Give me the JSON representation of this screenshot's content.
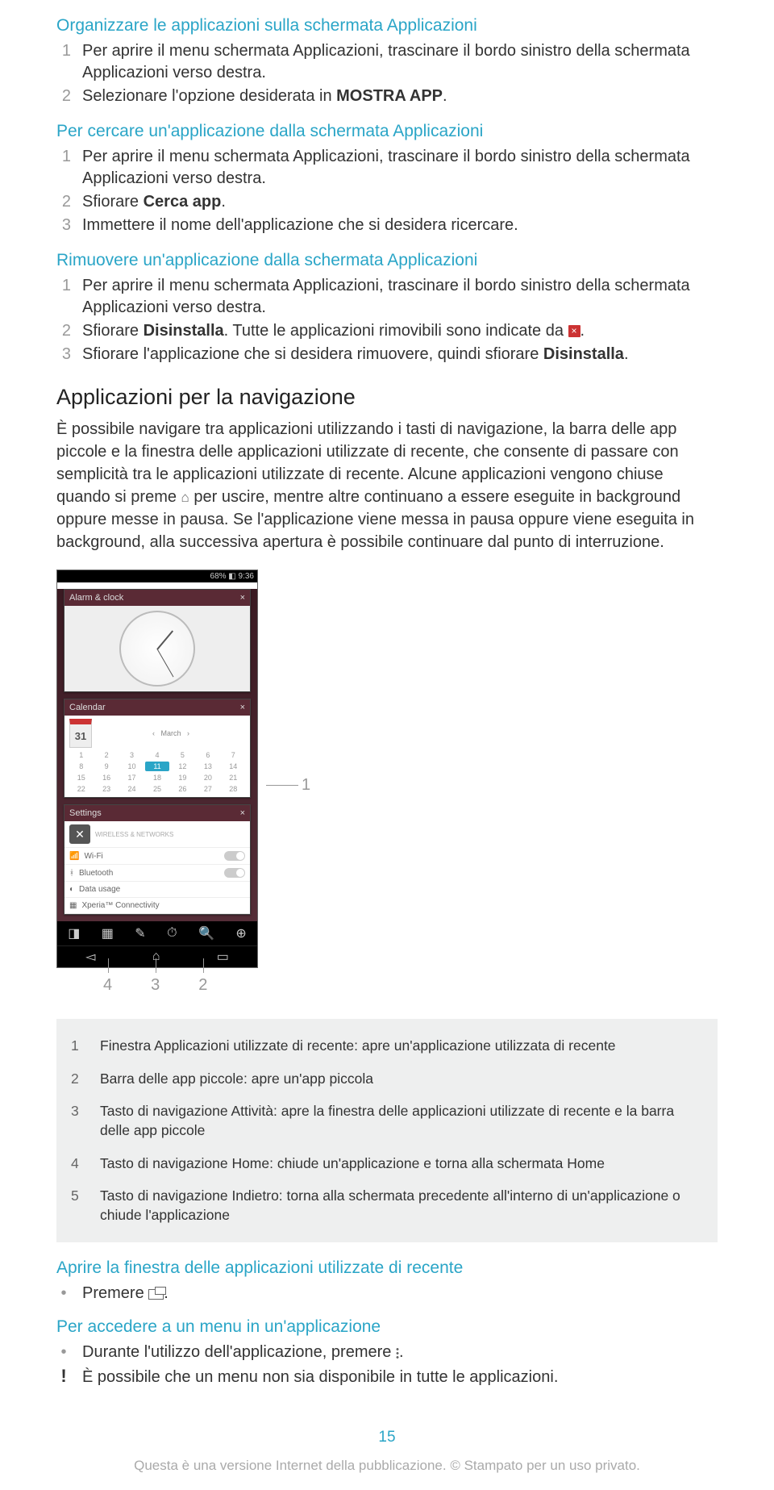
{
  "sec1": {
    "title": "Organizzare le applicazioni sulla schermata Applicazioni",
    "s1": "Per aprire il menu schermata Applicazioni, trascinare il bordo sinistro della schermata Applicazioni verso destra.",
    "s2a": "Selezionare l'opzione desiderata in ",
    "s2b": "MOSTRA APP",
    "s2c": "."
  },
  "sec2": {
    "title": "Per cercare un'applicazione dalla schermata Applicazioni",
    "s1": "Per aprire il menu schermata Applicazioni, trascinare il bordo sinistro della schermata Applicazioni verso destra.",
    "s2a": "Sfiorare ",
    "s2b": "Cerca app",
    "s2c": ".",
    "s3": "Immettere il nome dell'applicazione che si desidera ricercare."
  },
  "sec3": {
    "title": "Rimuovere un'applicazione dalla schermata Applicazioni",
    "s1": "Per aprire il menu schermata Applicazioni, trascinare il bordo sinistro della schermata Applicazioni verso destra.",
    "s2a": "Sfiorare ",
    "s2b": "Disinstalla",
    "s2c": ". Tutte le applicazioni rimovibili sono indicate da ",
    "s2d": ".",
    "s3a": "Sfiorare l'applicazione che si desidera rimuovere, quindi sfiorare ",
    "s3b": "Disinstalla",
    "s3c": "."
  },
  "h2": "Applicazioni per la navigazione",
  "para_a": "È possibile navigare tra applicazioni utilizzando i tasti di navigazione, la barra delle app piccole e la finestra delle applicazioni utilizzate di recente, che consente di passare con semplicità tra le applicazioni utilizzate di recente. Alcune applicazioni vengono chiuse quando si preme ",
  "para_b": " per uscire, mentre altre continuano a essere eseguite in background oppure messe in pausa. Se l'applicazione viene messa in pausa oppure viene eseguita in background, alla successiva apertura è possibile continuare dal punto di interruzione.",
  "phone": {
    "status": "68% ◧ 9:36",
    "card1": "Alarm & clock",
    "card2": "Calendar",
    "card2_day": "31",
    "card2_month": "March",
    "card3": "Settings",
    "set_sec": "WIRELESS & NETWORKS",
    "set1": "Wi-Fi",
    "set2": "Bluetooth",
    "set3": "Data usage",
    "set4": "Xperia™ Connectivity"
  },
  "callouts": {
    "r1": "1",
    "b4": "4",
    "b3": "3",
    "b2": "2"
  },
  "legend": {
    "r1": "Finestra Applicazioni utilizzate di recente: apre un'applicazione utilizzata di recente",
    "r2": "Barra delle app piccole: apre un'app piccola",
    "r3": "Tasto di navigazione Attività: apre la finestra delle applicazioni utilizzate di recente e la barra delle app piccole",
    "r4": "Tasto di navigazione Home: chiude un'applicazione e torna alla schermata Home",
    "r5": "Tasto di navigazione Indietro: torna alla schermata precedente all'interno di un'applicazione o chiude l'applicazione"
  },
  "sec4": {
    "title": "Aprire la finestra delle applicazioni utilizzate di recente",
    "b1a": "Premere ",
    "b1b": "."
  },
  "sec5": {
    "title": "Per accedere a un menu in un'applicazione",
    "b1a": "Durante l'utilizzo dell'applicazione, premere ",
    "b1b": ".",
    "warn": "È possibile che un menu non sia disponibile in tutte le applicazioni."
  },
  "page_num": "15",
  "footer": "Questa è una versione Internet della pubblicazione. © Stampato per un uso privato."
}
